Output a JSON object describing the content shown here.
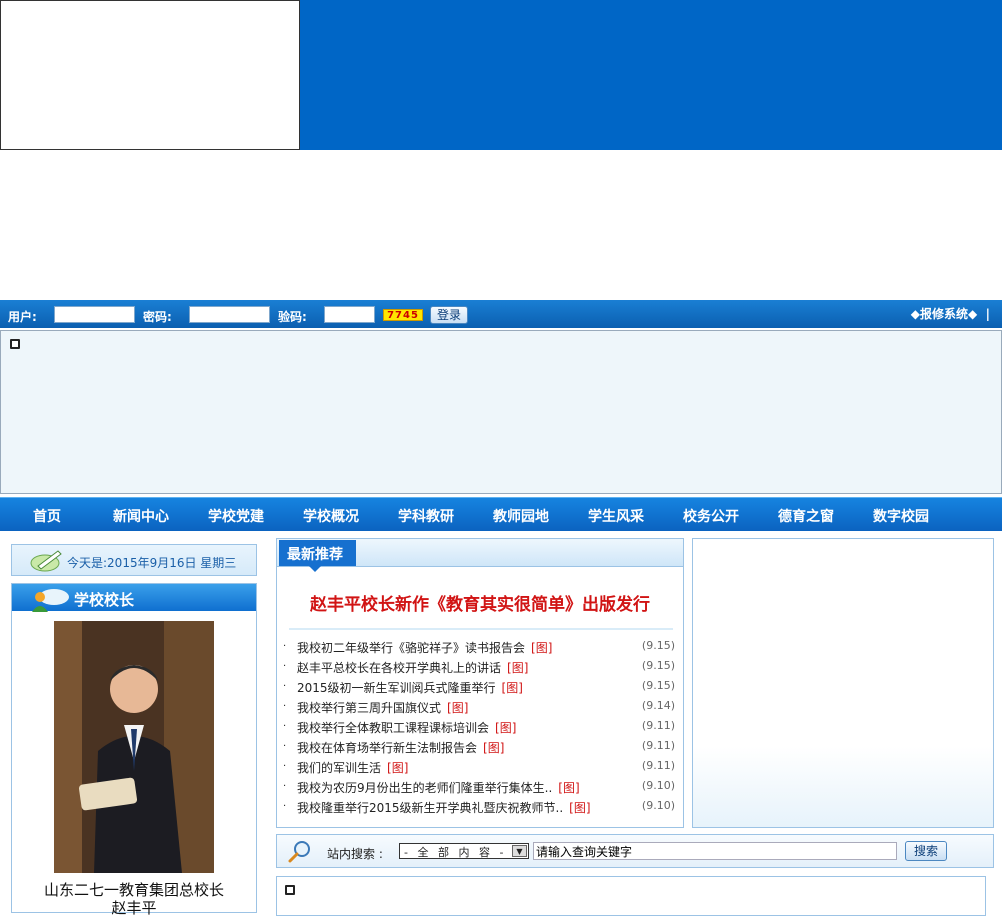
{
  "login": {
    "user_label": "用户:",
    "user_value": "",
    "password_label": "密码:",
    "password_value": "",
    "code_label": "验码:",
    "code_value": "",
    "captcha_text": "7745",
    "login_button": "登录",
    "repair_link": "◆报修系统◆"
  },
  "nav": {
    "items": [
      "首页",
      "新闻中心",
      "学校党建",
      "学校概况",
      "学科教研",
      "教师园地",
      "学生风采",
      "校务公开",
      "德育之窗",
      "数字校园"
    ]
  },
  "sidebar": {
    "date_text": "今天是:2015年9月16日 星期三",
    "principal_title": "学校校长",
    "principal_caption_line1": "山东二七一教育集团总校长",
    "principal_caption_line2": "赵丰平"
  },
  "news": {
    "tab_title": "最新推荐",
    "headline": "赵丰平校长新作《教育其实很简单》出版发行",
    "items": [
      {
        "title": "我校初二年级举行《骆驼祥子》读书报告会",
        "tag": "[图]",
        "date": "(9.15)"
      },
      {
        "title": "赵丰平总校长在各校开学典礼上的讲话",
        "tag": "[图]",
        "date": "(9.15)"
      },
      {
        "title": "2015级初一新生军训阅兵式隆重举行",
        "tag": "[图]",
        "date": "(9.15)"
      },
      {
        "title": "我校举行第三周升国旗仪式",
        "tag": "[图]",
        "date": "(9.14)"
      },
      {
        "title": "我校举行全体教职工课程课标培训会",
        "tag": "[图]",
        "date": "(9.11)"
      },
      {
        "title": "我校在体育场举行新生法制报告会",
        "tag": "[图]",
        "date": "(9.11)"
      },
      {
        "title": "我们的军训生活",
        "tag": "[图]",
        "date": "(9.11)"
      },
      {
        "title": "我校为农历9月份出生的老师们隆重举行集体生..",
        "tag": "[图]",
        "date": "(9.10)"
      },
      {
        "title": "我校隆重举行2015级新生开学典礼暨庆祝教师节..",
        "tag": "[图]",
        "date": "(9.10)"
      }
    ]
  },
  "search": {
    "label": "站内搜索 :",
    "scope_selected": "- 全 部 内 容 -",
    "input_value": "请输入查询关键字",
    "button": "搜索"
  },
  "colors": {
    "banner_blue": "#0066c6",
    "nav_blue": "#0b63c0",
    "headline_red": "#d11414"
  }
}
